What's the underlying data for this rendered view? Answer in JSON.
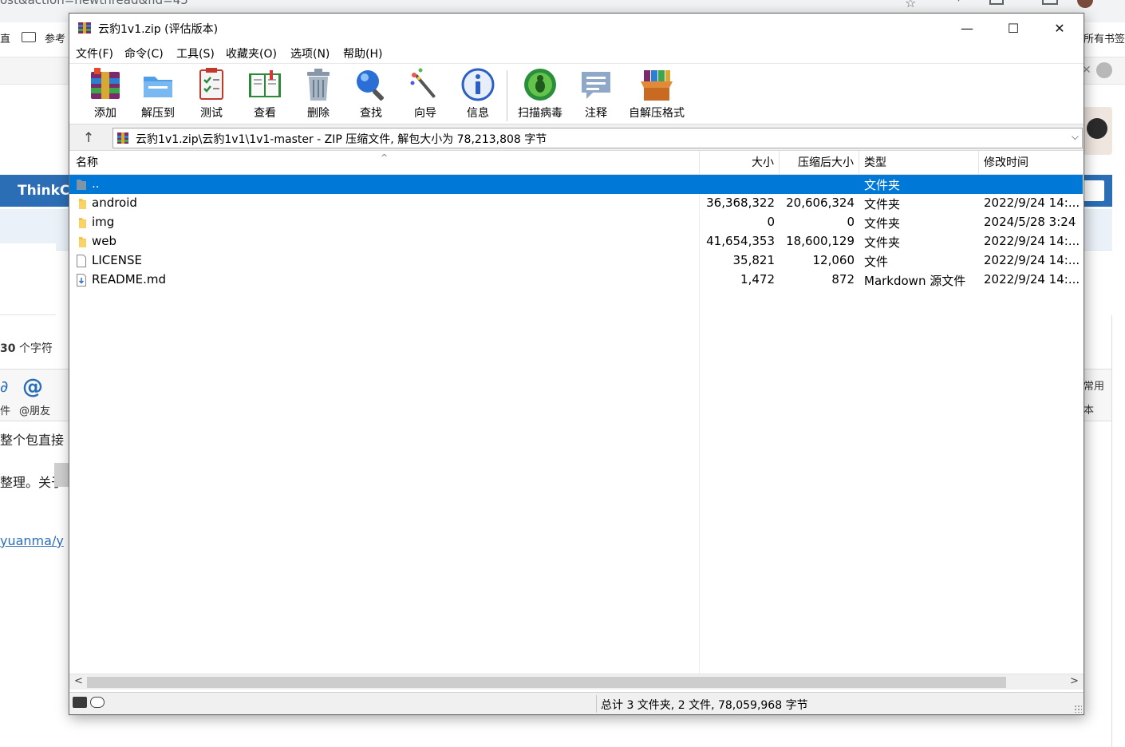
{
  "background": {
    "url_fragment": "ost&action=newthread&fid=45",
    "bookmarks": {
      "left_text": "直",
      "folder_label": "参考",
      "right_text": "所有书签"
    },
    "brand": "ThinkC",
    "char_count_number": "30",
    "char_count_unit": "个字符",
    "mention_label": "@朋友",
    "attach_label": "件",
    "body_line1": "整个包直接",
    "body_line2": "整理。关于",
    "link_text": "yuanma/y",
    "right_tab1": "常用",
    "right_tab2": "本"
  },
  "window": {
    "title": "云豹1v1.zip (评估版本)",
    "controls": {
      "minimize": "—",
      "maximize": "☐",
      "close": "✕"
    }
  },
  "menu": [
    {
      "label": "文件(F)"
    },
    {
      "label": "命令(C)"
    },
    {
      "label": "工具(S)"
    },
    {
      "label": "收藏夹(O)"
    },
    {
      "label": "选项(N)"
    },
    {
      "label": "帮助(H)"
    }
  ],
  "toolbar": [
    {
      "label": "添加",
      "icon": "add-archive-icon"
    },
    {
      "label": "解压到",
      "icon": "extract-to-icon"
    },
    {
      "label": "测试",
      "icon": "test-icon"
    },
    {
      "label": "查看",
      "icon": "view-icon"
    },
    {
      "label": "删除",
      "icon": "delete-icon"
    },
    {
      "label": "查找",
      "icon": "find-icon"
    },
    {
      "label": "向导",
      "icon": "wizard-icon"
    },
    {
      "label": "信息",
      "icon": "info-icon"
    },
    {
      "label": "扫描病毒",
      "icon": "virus-scan-icon"
    },
    {
      "label": "注释",
      "icon": "comment-icon"
    },
    {
      "label": "自解压格式",
      "icon": "sfx-icon"
    }
  ],
  "address": {
    "up_label": "↑",
    "path": "云豹1v1.zip\\云豹1v1\\1v1-master - ZIP 压缩文件, 解包大小为 78,213,808 字节"
  },
  "columns": {
    "name": "名称",
    "size": "大小",
    "packed": "压缩后大小",
    "type": "类型",
    "modified": "修改时间"
  },
  "files": [
    {
      "name": "..",
      "size": "",
      "packed": "",
      "type": "文件夹",
      "modified": "",
      "icon": "parent-folder-icon",
      "selected": true
    },
    {
      "name": "android",
      "size": "36,368,322",
      "packed": "20,606,324",
      "type": "文件夹",
      "modified": "2022/9/24 14:...",
      "icon": "folder-icon",
      "selected": false
    },
    {
      "name": "img",
      "size": "0",
      "packed": "0",
      "type": "文件夹",
      "modified": "2024/5/28 3:24",
      "icon": "folder-icon",
      "selected": false
    },
    {
      "name": "web",
      "size": "41,654,353",
      "packed": "18,600,129",
      "type": "文件夹",
      "modified": "2022/9/24 14:...",
      "icon": "folder-icon",
      "selected": false
    },
    {
      "name": "LICENSE",
      "size": "35,821",
      "packed": "12,060",
      "type": "文件",
      "modified": "2022/9/24 14:...",
      "icon": "file-icon",
      "selected": false
    },
    {
      "name": "README.md",
      "size": "1,472",
      "packed": "872",
      "type": "Markdown 源文件",
      "modified": "2022/9/24 14:...",
      "icon": "markdown-file-icon",
      "selected": false
    }
  ],
  "status": {
    "summary": "总计 3 文件夹, 2 文件, 78,059,968 字节"
  },
  "colors": {
    "selection": "#0078d7",
    "folder": "#f5c542"
  }
}
